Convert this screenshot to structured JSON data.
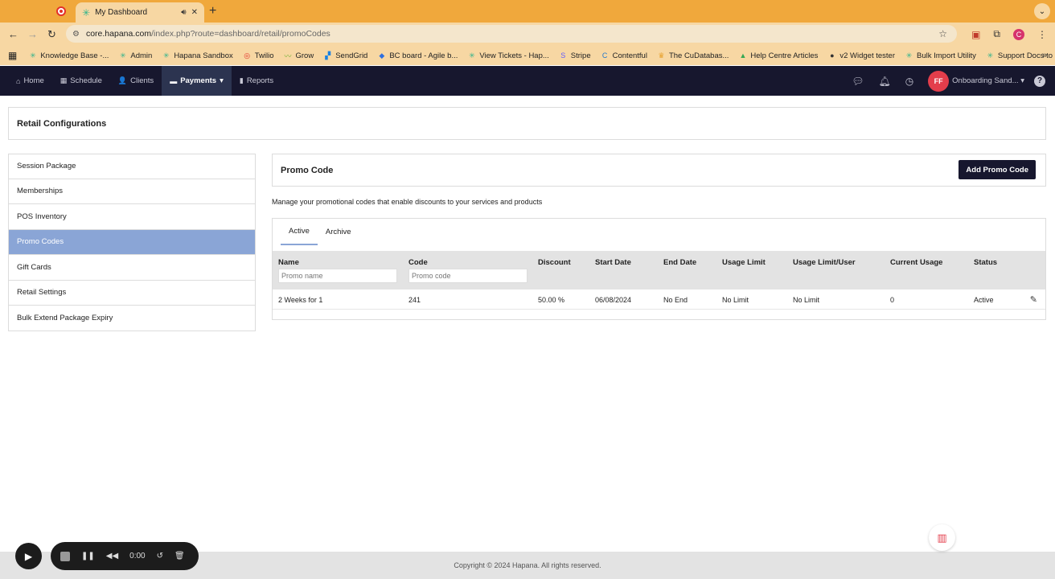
{
  "browser": {
    "tab_title": "My Dashboard",
    "url_host": "core.hapana.com",
    "url_path": "/index.php?route=dashboard/retail/promoCodes",
    "bookmarks": [
      {
        "label": "Knowledge Base -...",
        "color": "#2fb38b",
        "glyph": "✳"
      },
      {
        "label": "Admin",
        "color": "#2fb38b",
        "glyph": "✳"
      },
      {
        "label": "Hapana Sandbox",
        "color": "#2fb38b",
        "glyph": "✳"
      },
      {
        "label": "Twilio",
        "color": "#e2322b",
        "glyph": "◎"
      },
      {
        "label": "Grow",
        "color": "#7bb33a",
        "glyph": "〰"
      },
      {
        "label": "SendGrid",
        "color": "#1a82e2",
        "glyph": "▞"
      },
      {
        "label": "BC board - Agile b...",
        "color": "#2f6fde",
        "glyph": "◆"
      },
      {
        "label": "View Tickets - Hap...",
        "color": "#2fb38b",
        "glyph": "✳"
      },
      {
        "label": "Stripe",
        "color": "#635bff",
        "glyph": "S"
      },
      {
        "label": "Contentful",
        "color": "#2478cc",
        "glyph": "C"
      },
      {
        "label": "The CuDatabas...",
        "color": "#e7a12d",
        "glyph": "♛"
      },
      {
        "label": "Help Centre Articles",
        "color": "#34a853",
        "glyph": "▲"
      },
      {
        "label": "v2 Widget tester",
        "color": "#333333",
        "glyph": "●"
      },
      {
        "label": "Bulk Import Utility",
        "color": "#2fb38b",
        "glyph": "✳"
      },
      {
        "label": "Support Docs to R...",
        "color": "#2fb38b",
        "glyph": "✳"
      }
    ],
    "profile_initial": "C"
  },
  "appnav": {
    "items": [
      {
        "label": "Home",
        "icon": "home-icon",
        "glyph": "⌂"
      },
      {
        "label": "Schedule",
        "icon": "calendar-icon",
        "glyph": "▦"
      },
      {
        "label": "Clients",
        "icon": "user-icon",
        "glyph": "👤"
      },
      {
        "label": "Payments",
        "icon": "card-icon",
        "glyph": "▬"
      },
      {
        "label": "Reports",
        "icon": "chart-icon",
        "glyph": "▮"
      }
    ],
    "avatar_initials": "FF",
    "org_name": "Onboarding Sand..."
  },
  "page": {
    "config_title": "Retail Configurations",
    "sidebar": [
      "Session Package",
      "Memberships",
      "POS Inventory",
      "Promo Codes",
      "Gift Cards",
      "Retail Settings",
      "Bulk Extend Package Expiry"
    ],
    "active_sidebar_index": 3,
    "promo_title": "Promo Code",
    "add_button": "Add Promo Code",
    "description": "Manage your promotional codes that enable discounts to your services and products",
    "tabs": [
      "Active",
      "Archive"
    ],
    "columns": [
      "Name",
      "Code",
      "Discount",
      "Start Date",
      "End Date",
      "Usage Limit",
      "Usage Limit/User",
      "Current Usage",
      "Status"
    ],
    "filters": {
      "name_placeholder": "Promo name",
      "code_placeholder": "Promo code"
    },
    "rows": [
      [
        "2 Weeks for 1",
        "241",
        "50.00 %",
        "06/08/2024",
        "No End",
        "No Limit",
        "No Limit",
        "0",
        "Active"
      ]
    ],
    "accent": "#8aa5d6",
    "nav_bg": "#17172e"
  },
  "footer": {
    "copyright": "Copyright © 2024 Hapana. All rights reserved."
  },
  "recorder": {
    "time": "0:00"
  }
}
